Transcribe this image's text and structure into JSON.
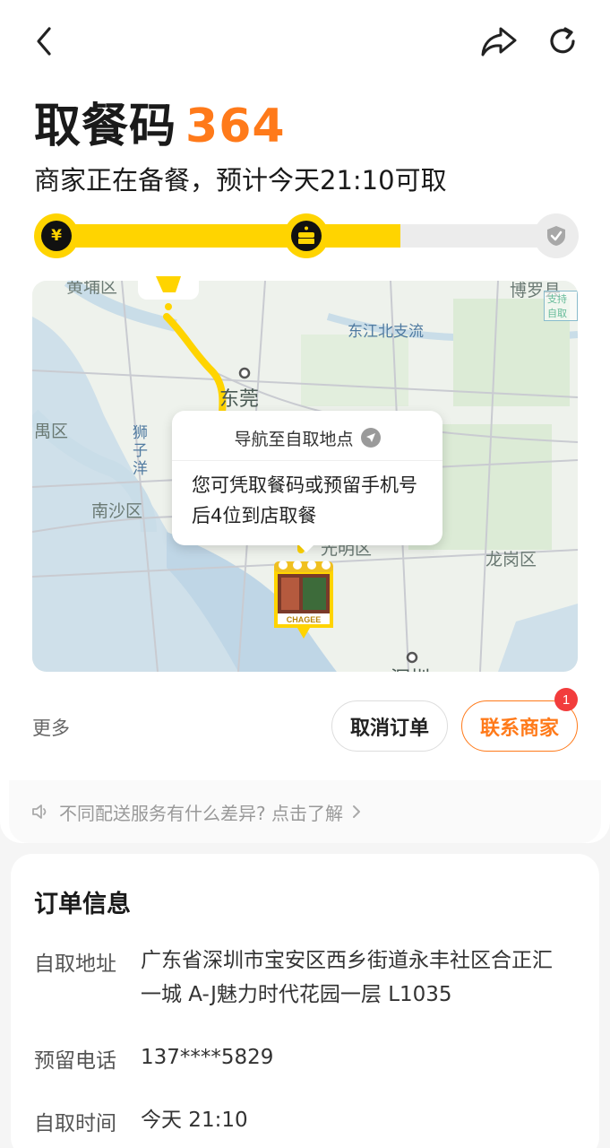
{
  "header": {
    "title_prefix": "取餐码",
    "pickup_code": "364",
    "status_text": "商家正在备餐，预计今天21:10可取"
  },
  "progress": {
    "fraction": 0.68,
    "steps": [
      {
        "name": "paid",
        "icon": "yen-icon",
        "state": "done",
        "glyph": "¥"
      },
      {
        "name": "preparing",
        "icon": "cake-icon",
        "state": "active"
      },
      {
        "name": "completed",
        "icon": "check-icon",
        "state": "pending"
      }
    ]
  },
  "map": {
    "labels": {
      "huangpu": "黄埔区",
      "boluo": "博罗县",
      "dongjiang": "东江北支流",
      "dongguan": "东莞",
      "panyu": "禺区",
      "shiziyang": "狮子洋",
      "nansha": "南沙区",
      "longgang": "龙岗区",
      "guangming": "光明区",
      "shenzhen": "深圳"
    },
    "corner_badge": "支持自取",
    "nav_label": "导航至自取地点",
    "message": "您可凭取餐码或预留手机号后4位到店取餐",
    "store_brand": "CHAGEE"
  },
  "actions": {
    "more": "更多",
    "cancel": "取消订单",
    "contact": "联系商家",
    "contact_badge": "1"
  },
  "tip": {
    "text": "不同配送服务有什么差异? 点击了解"
  },
  "order": {
    "title": "订单信息",
    "address_label": "自取地址",
    "address_value": "广东省深圳市宝安区西乡街道永丰社区合正汇一城 A-J魅力时代花园一层 L1035",
    "phone_label": "预留电话",
    "phone_value": "137****5829",
    "time_label": "自取时间",
    "time_value": "今天 21:10"
  },
  "colors": {
    "accent": "#ff7a1a",
    "progress": "#ffd400",
    "badge": "#f23c3c"
  }
}
